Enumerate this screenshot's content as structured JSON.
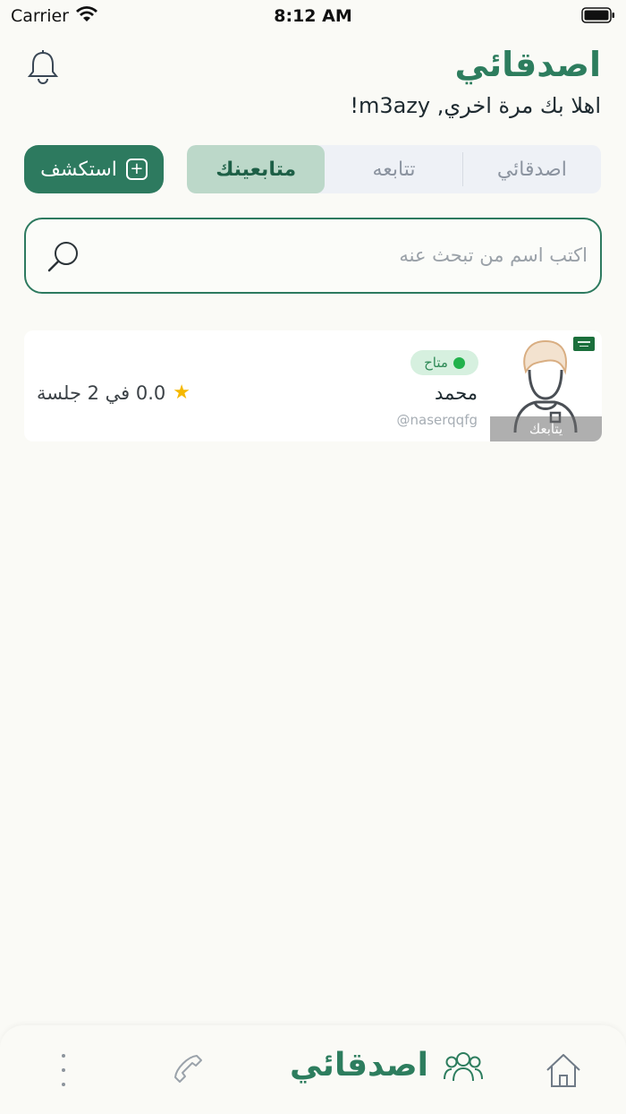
{
  "status_bar": {
    "carrier": "Carrier",
    "time": "8:12 AM"
  },
  "header": {
    "title": "اصدقائي",
    "greeting": "اهلا بك مرة اخري, m3azy!"
  },
  "explore_button": {
    "label": "استكشف"
  },
  "tabs": [
    {
      "label": "اصدقائي",
      "active": false
    },
    {
      "label": "تتابعه",
      "active": false
    },
    {
      "label": "متابعينك",
      "active": true
    }
  ],
  "search": {
    "placeholder": "اكتب اسم من تبحث عنه"
  },
  "followers": [
    {
      "name": "محمد",
      "username": "@naserqqfg",
      "status": "متاح",
      "rating_text": "0.0 في 2 جلسة",
      "follows_you": "يتابعك",
      "flag": "saudi-flag-icon"
    }
  ],
  "bottom_nav": {
    "friends_label": "اصدقائي"
  },
  "colors": {
    "accent": "#2d7a5f",
    "active_tab": "#bcd8c9",
    "available": "#22b24c",
    "star": "#f5b800"
  }
}
